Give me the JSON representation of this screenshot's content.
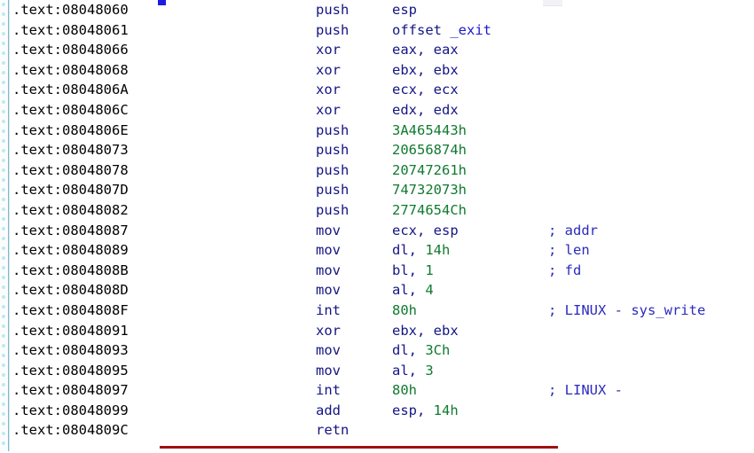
{
  "app": {
    "view_name": "ida-disassembly-listing",
    "segment": ".text"
  },
  "colors": {
    "background": "#ffffff",
    "address_text": "#000000",
    "mnemonic": "#151585",
    "register": "#151585",
    "number": "#107a2f",
    "name_reference": "#1a1acc",
    "comment": "#2b2bbe",
    "function_end_rule": "#a01010",
    "gutter_arrow": "#8fd8e0",
    "selection_marker": "#1c1ce0"
  },
  "decorations": {
    "selection_marker_name": "cursor-selection-marker",
    "function_end_rule_name": "function-end-separator",
    "gutter_name": "arrows-graph-gutter"
  },
  "listing": {
    "lines": [
      {
        "address": ".text:08048060",
        "mnemonic": "push",
        "operands": [
          {
            "text": "esp",
            "kind": "reg"
          }
        ],
        "comment": ""
      },
      {
        "address": ".text:08048061",
        "mnemonic": "push",
        "operands": [
          {
            "text": "offset ",
            "kind": "kw"
          },
          {
            "text": "_exit",
            "kind": "name"
          }
        ],
        "comment": ""
      },
      {
        "address": ".text:08048066",
        "mnemonic": "xor",
        "operands": [
          {
            "text": "eax, eax",
            "kind": "reg"
          }
        ],
        "comment": ""
      },
      {
        "address": ".text:08048068",
        "mnemonic": "xor",
        "operands": [
          {
            "text": "ebx, ebx",
            "kind": "reg"
          }
        ],
        "comment": ""
      },
      {
        "address": ".text:0804806A",
        "mnemonic": "xor",
        "operands": [
          {
            "text": "ecx, ecx",
            "kind": "reg"
          }
        ],
        "comment": ""
      },
      {
        "address": ".text:0804806C",
        "mnemonic": "xor",
        "operands": [
          {
            "text": "edx, edx",
            "kind": "reg"
          }
        ],
        "comment": ""
      },
      {
        "address": ".text:0804806E",
        "mnemonic": "push",
        "operands": [
          {
            "text": "3A465443h",
            "kind": "num"
          }
        ],
        "comment": ""
      },
      {
        "address": ".text:08048073",
        "mnemonic": "push",
        "operands": [
          {
            "text": "20656874h",
            "kind": "num"
          }
        ],
        "comment": ""
      },
      {
        "address": ".text:08048078",
        "mnemonic": "push",
        "operands": [
          {
            "text": "20747261h",
            "kind": "num"
          }
        ],
        "comment": ""
      },
      {
        "address": ".text:0804807D",
        "mnemonic": "push",
        "operands": [
          {
            "text": "74732073h",
            "kind": "num"
          }
        ],
        "comment": ""
      },
      {
        "address": ".text:08048082",
        "mnemonic": "push",
        "operands": [
          {
            "text": "2774654Ch",
            "kind": "num"
          }
        ],
        "comment": ""
      },
      {
        "address": ".text:08048087",
        "mnemonic": "mov",
        "operands": [
          {
            "text": "ecx, esp",
            "kind": "reg"
          }
        ],
        "comment": "; addr"
      },
      {
        "address": ".text:08048089",
        "mnemonic": "mov",
        "operands": [
          {
            "text": "dl, ",
            "kind": "reg"
          },
          {
            "text": "14h",
            "kind": "num"
          }
        ],
        "comment": "; len"
      },
      {
        "address": ".text:0804808B",
        "mnemonic": "mov",
        "operands": [
          {
            "text": "bl, ",
            "kind": "reg"
          },
          {
            "text": "1",
            "kind": "num"
          }
        ],
        "comment": "; fd"
      },
      {
        "address": ".text:0804808D",
        "mnemonic": "mov",
        "operands": [
          {
            "text": "al, ",
            "kind": "reg"
          },
          {
            "text": "4",
            "kind": "num"
          }
        ],
        "comment": ""
      },
      {
        "address": ".text:0804808F",
        "mnemonic": "int",
        "operands": [
          {
            "text": "80h",
            "kind": "num"
          }
        ],
        "comment": "; LINUX - sys_write"
      },
      {
        "address": ".text:08048091",
        "mnemonic": "xor",
        "operands": [
          {
            "text": "ebx, ebx",
            "kind": "reg"
          }
        ],
        "comment": ""
      },
      {
        "address": ".text:08048093",
        "mnemonic": "mov",
        "operands": [
          {
            "text": "dl, ",
            "kind": "reg"
          },
          {
            "text": "3Ch",
            "kind": "num"
          }
        ],
        "comment": ""
      },
      {
        "address": ".text:08048095",
        "mnemonic": "mov",
        "operands": [
          {
            "text": "al, ",
            "kind": "reg"
          },
          {
            "text": "3",
            "kind": "num"
          }
        ],
        "comment": ""
      },
      {
        "address": ".text:08048097",
        "mnemonic": "int",
        "operands": [
          {
            "text": "80h",
            "kind": "num"
          }
        ],
        "comment": "; LINUX - "
      },
      {
        "address": ".text:08048099",
        "mnemonic": "add",
        "operands": [
          {
            "text": "esp, ",
            "kind": "reg"
          },
          {
            "text": "14h",
            "kind": "num"
          }
        ],
        "comment": ""
      },
      {
        "address": ".text:0804809C",
        "mnemonic": "retn",
        "operands": [],
        "comment": ""
      }
    ]
  }
}
